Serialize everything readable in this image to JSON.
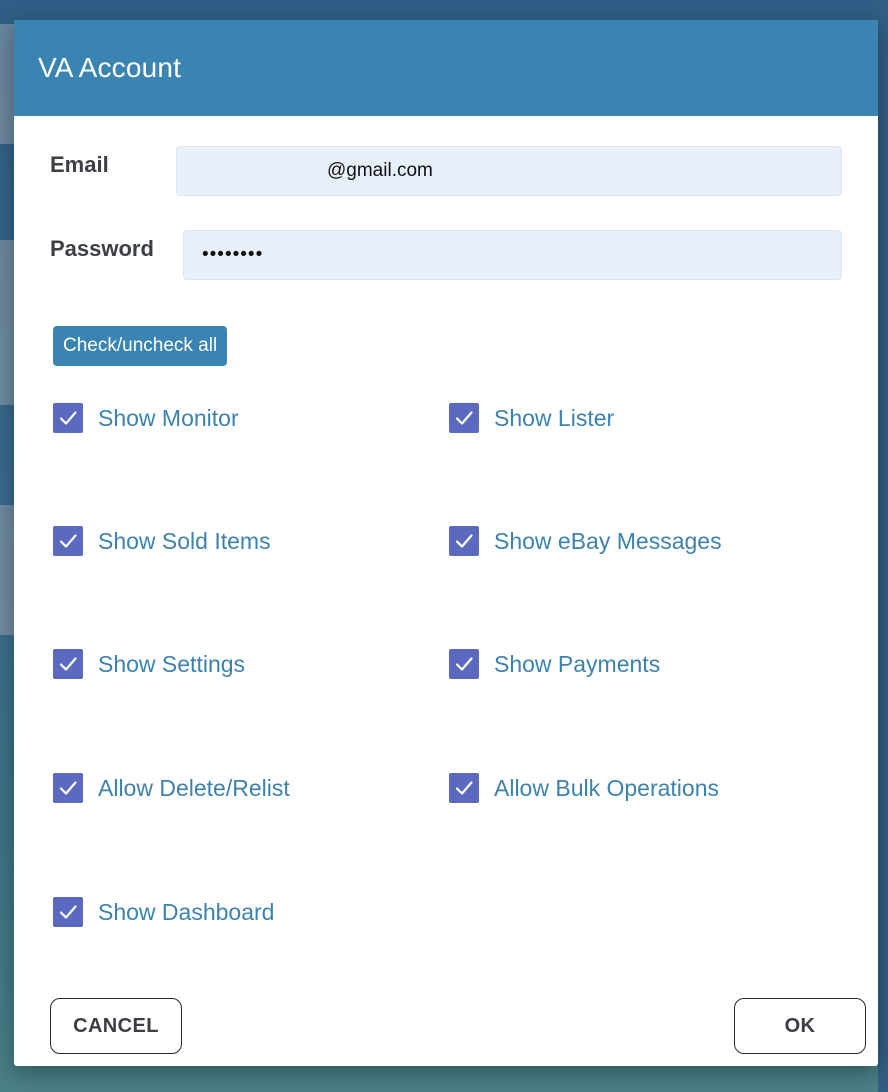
{
  "dialog": {
    "title": "VA Account"
  },
  "form": {
    "email_label": "Email",
    "email_value": "@gmail.com",
    "password_label": "Password",
    "password_value": "••••••••"
  },
  "check_all_label": "Check/uncheck all",
  "permissions": [
    {
      "label": "Show Monitor",
      "checked": true
    },
    {
      "label": "Show Lister",
      "checked": true
    },
    {
      "label": "Show Sold Items",
      "checked": true
    },
    {
      "label": "Show eBay Messages",
      "checked": true
    },
    {
      "label": "Show Settings",
      "checked": true
    },
    {
      "label": "Show Payments",
      "checked": true
    },
    {
      "label": "Allow Delete/Relist",
      "checked": true
    },
    {
      "label": "Allow Bulk Operations",
      "checked": true
    },
    {
      "label": "Show Dashboard",
      "checked": true
    }
  ],
  "footer": {
    "cancel_label": "CANCEL",
    "ok_label": "OK"
  },
  "colors": {
    "header": "#3a84b2",
    "checkbox": "#5b6abf",
    "link_text": "#3d82ad",
    "input_bg": "#e9f0fd"
  },
  "icons": {
    "checkbox": "checkmark-icon"
  }
}
